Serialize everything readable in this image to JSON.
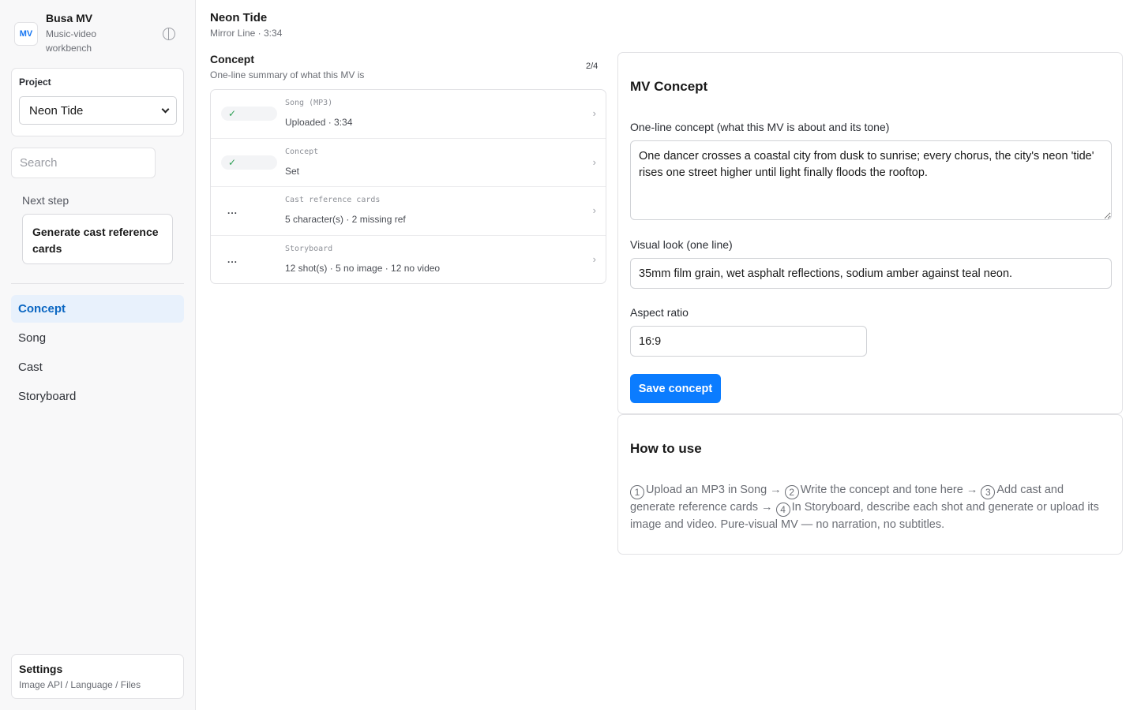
{
  "brand": {
    "logo_text": "MV",
    "name": "Busa MV",
    "subtitle": "Music-video workbench",
    "theme_icon": "half-circle-icon"
  },
  "project": {
    "label": "Project",
    "selected": "Neon Tide"
  },
  "search": {
    "placeholder": "Search",
    "value": ""
  },
  "next_step": {
    "label": "Next step",
    "action": "Generate cast reference cards"
  },
  "nav": {
    "items": [
      {
        "label": "Concept",
        "active": true
      },
      {
        "label": "Song",
        "active": false
      },
      {
        "label": "Cast",
        "active": false
      },
      {
        "label": "Storyboard",
        "active": false
      }
    ]
  },
  "settings": {
    "title": "Settings",
    "subtitle": "Image API / Language / Files"
  },
  "header": {
    "title": "Neon Tide",
    "subtitle": "Mirror Line · 3:34"
  },
  "workflow": {
    "title": "Concept",
    "subtitle": "One-line summary of what this MV is",
    "progress": "2/4",
    "steps": [
      {
        "name": "Song (MP3)",
        "status": "Uploaded · 3:34",
        "state": "✓",
        "done": true
      },
      {
        "name": "Concept",
        "status": "Set",
        "state": "✓",
        "done": true
      },
      {
        "name": "Cast reference cards",
        "status": "5 character(s) · 2 missing ref",
        "state": "...",
        "done": false
      },
      {
        "name": "Storyboard",
        "status": "12 shot(s) · 5 no image · 12 no video",
        "state": "...",
        "done": false
      }
    ],
    "arrow": "›"
  },
  "concept_form": {
    "title": "MV Concept",
    "concept_label": "One-line concept (what this MV is about and its tone)",
    "concept_value": "One dancer crosses a coastal city from dusk to sunrise; every chorus, the city's neon 'tide' rises one street higher until light finally floods the rooftop.",
    "look_label": "Visual look (one line)",
    "look_value": "35mm film grain, wet asphalt reflections, sodium amber against teal neon.",
    "aspect_label": "Aspect ratio",
    "aspect_value": "16:9",
    "save_label": "Save concept"
  },
  "howto": {
    "title": "How to use",
    "steps": [
      {
        "num": "1",
        "text": "Upload an MP3 in Song →"
      },
      {
        "num": "2",
        "text": "Write the concept and tone here →"
      },
      {
        "num": "3",
        "text": "Add cast and generate reference cards →"
      },
      {
        "num": "4",
        "text": "In Storyboard, describe each shot and generate or upload its image and video. Pure-visual MV — no narration, no subtitles."
      }
    ]
  },
  "colors": {
    "accent": "#0b7cff",
    "nav_active_bg": "#e8f1fc",
    "nav_active_text": "#0a66c2",
    "done_check": "#2e9f55"
  }
}
